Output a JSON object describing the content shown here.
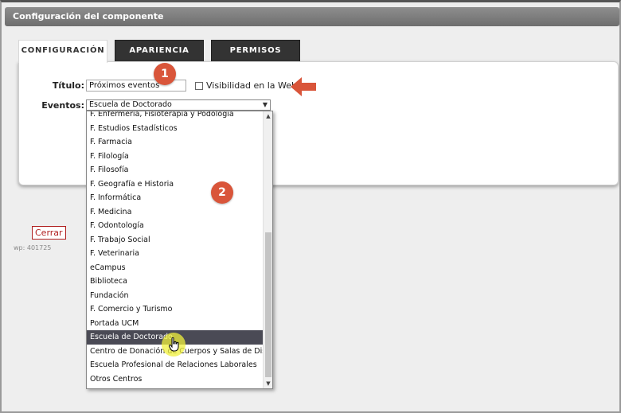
{
  "window": {
    "title": "Configuración del componente"
  },
  "tabs": [
    {
      "label": "CONFIGURACIÓN"
    },
    {
      "label": "APARIENCIA"
    },
    {
      "label": "PERMISOS"
    }
  ],
  "form": {
    "titulo_label": "Título:",
    "titulo_value": "Próximos eventos",
    "visibilidad_label": "Visibilidad en la Web",
    "eventos_label": "Eventos:",
    "eventos_selected": "Escuela de Doctorado"
  },
  "dropdown": {
    "options": [
      "F. Enfermería, Fisioterapia y Podología",
      "F. Estudios Estadísticos",
      "F. Farmacia",
      "F. Filología",
      "F. Filosofía",
      "F. Geografía e Historia",
      "F. Informática",
      "F. Medicina",
      "F. Odontología",
      "F. Trabajo Social",
      "F. Veterinaria",
      "eCampus",
      "Biblioteca",
      "Fundación",
      "F. Comercio y Turismo",
      "Portada UCM",
      "Escuela de Doctorado",
      "Centro de Donación de Cuerpos y Salas de Disección",
      "Escuela Profesional de Relaciones Laborales",
      "Otros Centros"
    ],
    "selected_index": 16
  },
  "annotations": {
    "badge1": "1",
    "badge2": "2"
  },
  "footer": {
    "close_label": "Cerrar",
    "wp_id": "wp: 401725"
  },
  "colors": {
    "accent": "#d9553a",
    "tab_dark": "#333333",
    "selected_bg": "#4a4a55",
    "close_red": "#b01f1f"
  }
}
